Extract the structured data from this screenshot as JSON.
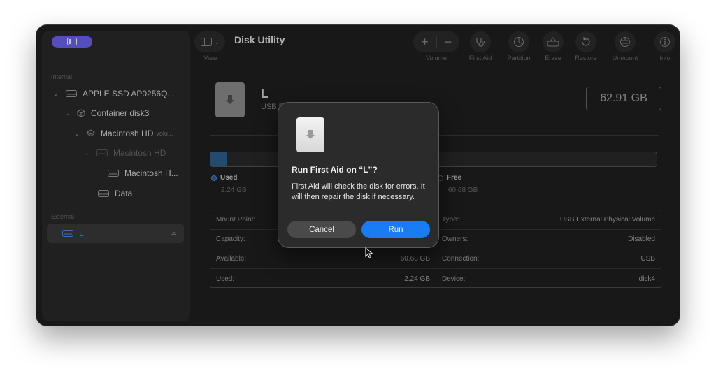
{
  "app": {
    "title": "Disk Utility",
    "accent_color": "#6e63f0"
  },
  "toolbar": {
    "view_label": "View",
    "volume_label": "Volume",
    "first_aid_label": "First Aid",
    "partition_label": "Partition",
    "erase_label": "Erase",
    "restore_label": "Restore",
    "unmount_label": "Unmount",
    "info_label": "Info"
  },
  "sidebar": {
    "internal_label": "Internal",
    "external_label": "External",
    "items": [
      {
        "label": "APPLE SSD AP0256Q..."
      },
      {
        "label": "Container disk3"
      },
      {
        "label": "Macintosh HD",
        "sub": "volu..."
      },
      {
        "label": "Macintosh HD"
      },
      {
        "label": "Macintosh H..."
      },
      {
        "label": "Data"
      },
      {
        "label": "L"
      }
    ]
  },
  "volume": {
    "name": "L",
    "subtitle": "USB E",
    "size": "62.91 GB",
    "used_label": "Used",
    "used_value": "2.24 GB",
    "free_label": "Free",
    "free_value": "60.68 GB",
    "used_fraction": 0.036
  },
  "info": {
    "left": [
      {
        "label": "Mount Point:",
        "value": ""
      },
      {
        "label": "Capacity:",
        "value": ""
      },
      {
        "label": "Available:",
        "value": "60.68 GB"
      },
      {
        "label": "Used:",
        "value": "2.24 GB"
      }
    ],
    "right": [
      {
        "label": "Type:",
        "value": "USB External Physical Volume"
      },
      {
        "label": "Owners:",
        "value": "Disabled"
      },
      {
        "label": "Connection:",
        "value": "USB"
      },
      {
        "label": "Device:",
        "value": "disk4"
      }
    ]
  },
  "dialog": {
    "title": "Run First Aid on “L”?",
    "message": "First Aid will check the disk for errors. It will then repair the disk if necessary.",
    "cancel_label": "Cancel",
    "run_label": "Run"
  }
}
